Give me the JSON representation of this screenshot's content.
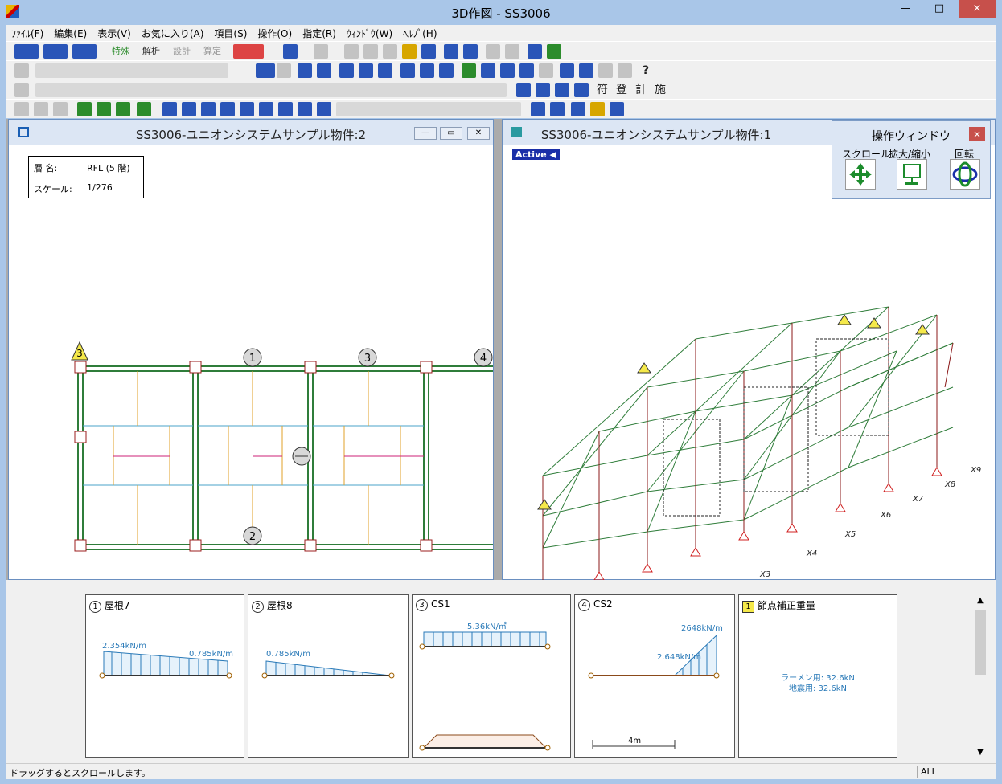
{
  "app": {
    "title": "3D作図 - SS3006"
  },
  "window_buttons": {
    "minimize": "—",
    "maximize": "□",
    "close": "×"
  },
  "menu": [
    "ﾌｧｲﾙ(F)",
    "編集(E)",
    "表示(V)",
    "お気に入り(A)",
    "項目(S)",
    "操作(O)",
    "指定(R)",
    "ｳｨﾝﾄﾞｳ(W)",
    "ﾍﾙﾌﾟ(H)"
  ],
  "toolbar": {
    "row1": [
      "特殊",
      "解析",
      "設計",
      "算定"
    ],
    "row3": [
      "符",
      "登",
      "計",
      "施"
    ]
  },
  "child_left": {
    "title": "SS3006-ユニオンシステムサンプル物件:2",
    "layer_label": "層 名:",
    "layer_value": "RFL (5 階)",
    "scale_label": "スケール:",
    "scale_value": "1/276",
    "markers": [
      "3",
      "1",
      "3",
      "4",
      "2"
    ]
  },
  "child_right": {
    "title": "SS3006-ユニオンシステムサンプル物件:1",
    "active_badge": "Active ◀",
    "axis_labels": [
      "X3",
      "X4",
      "X5",
      "X6",
      "X7",
      "X8",
      "X9"
    ]
  },
  "op_window": {
    "title": "操作ウィンドウ",
    "close": "×",
    "labels": [
      "スクロール",
      "拡大/縮小",
      "回転"
    ]
  },
  "panels": [
    {
      "num": "1",
      "name": "屋根7",
      "v1": "2.354kN/m",
      "v2": "0.785kN/m"
    },
    {
      "num": "2",
      "name": "屋根8",
      "v1": "0.785kN/m"
    },
    {
      "num": "3",
      "name": "CS1",
      "v1": "5.36kN/㎡"
    },
    {
      "num": "4",
      "name": "CS2",
      "v1": "2648kN/m",
      "v2": "2.648kN/m",
      "dim": "4m"
    },
    {
      "num": "1",
      "name": "節点補正重量",
      "v1": "ラーメン用: 32.6kN",
      "v2": "地震用: 32.6kN"
    }
  ],
  "status": {
    "text": "ドラッグするとスクロールします。",
    "right": "ALL"
  },
  "colors": {
    "accent": "#1a2fa8",
    "frame": "#2f7d3a",
    "beam": "#8b1a1a"
  }
}
